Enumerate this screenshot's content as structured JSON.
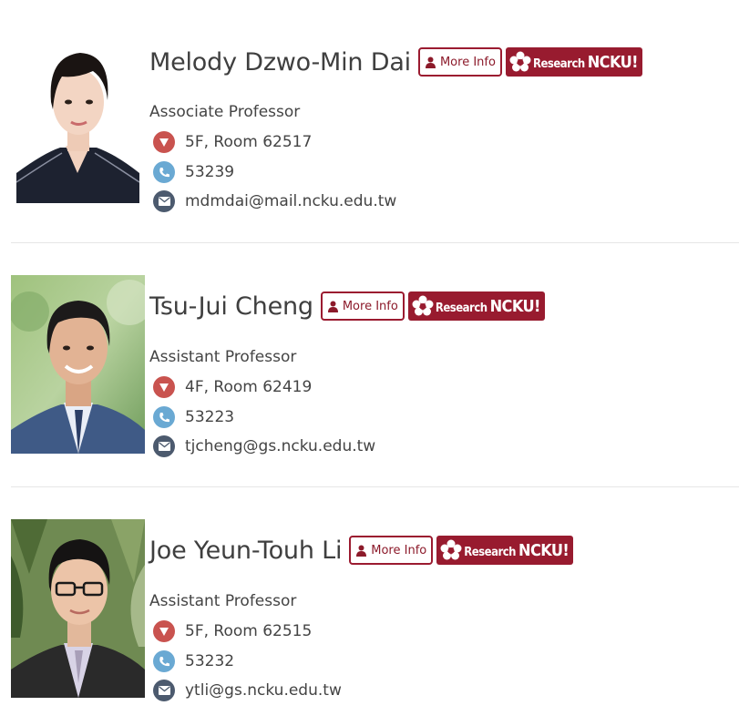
{
  "buttons": {
    "more_info_label": "More Info",
    "research_small": "Research",
    "research_big": "NCKU!"
  },
  "colors": {
    "brand": "#981b2f",
    "office_icon": "#c9534f",
    "phone_icon": "#6aa9d3",
    "email_icon": "#4c5a6e"
  },
  "icons": {
    "more_info": "user-icon",
    "research": "flower-logo-icon",
    "office": "location-pin-icon",
    "phone": "phone-icon",
    "email": "envelope-icon"
  },
  "faculty": [
    {
      "name": "Melody Dzwo-Min Dai",
      "title": "Associate Professor",
      "office": "5F, Room 62517",
      "phone": "53239",
      "email": "mdmdai@mail.ncku.edu.tw"
    },
    {
      "name": "Tsu-Jui Cheng",
      "title": "Assistant Professor",
      "office": "4F, Room 62419",
      "phone": "53223",
      "email": "tjcheng@gs.ncku.edu.tw"
    },
    {
      "name": "Joe Yeun-Touh Li",
      "title": "Assistant Professor",
      "office": "5F, Room 62515",
      "phone": "53232",
      "email": "ytli@gs.ncku.edu.tw"
    }
  ]
}
